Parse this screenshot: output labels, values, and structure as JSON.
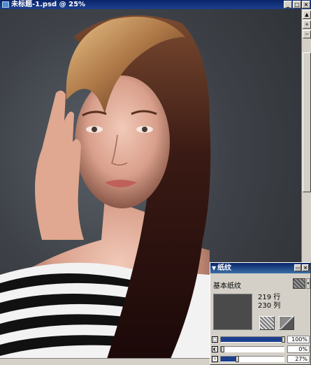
{
  "window": {
    "title": "未标题-1.psd @ 25%"
  },
  "statusbar": {
    "text": ""
  },
  "palette": {
    "title": "纸纹",
    "paper_name": "基本纸纹",
    "rows_label": "219 行",
    "cols_label": "230 列",
    "sliders": [
      {
        "name": "scale",
        "value_label": "100%",
        "level": 1.0
      },
      {
        "name": "contrast",
        "value_label": "0%",
        "level": 0.0
      },
      {
        "name": "brightness",
        "value_label": "27%",
        "level": 0.27
      }
    ]
  },
  "colors": {
    "accent": "#0a246a",
    "panel": "#d4d0c8"
  }
}
